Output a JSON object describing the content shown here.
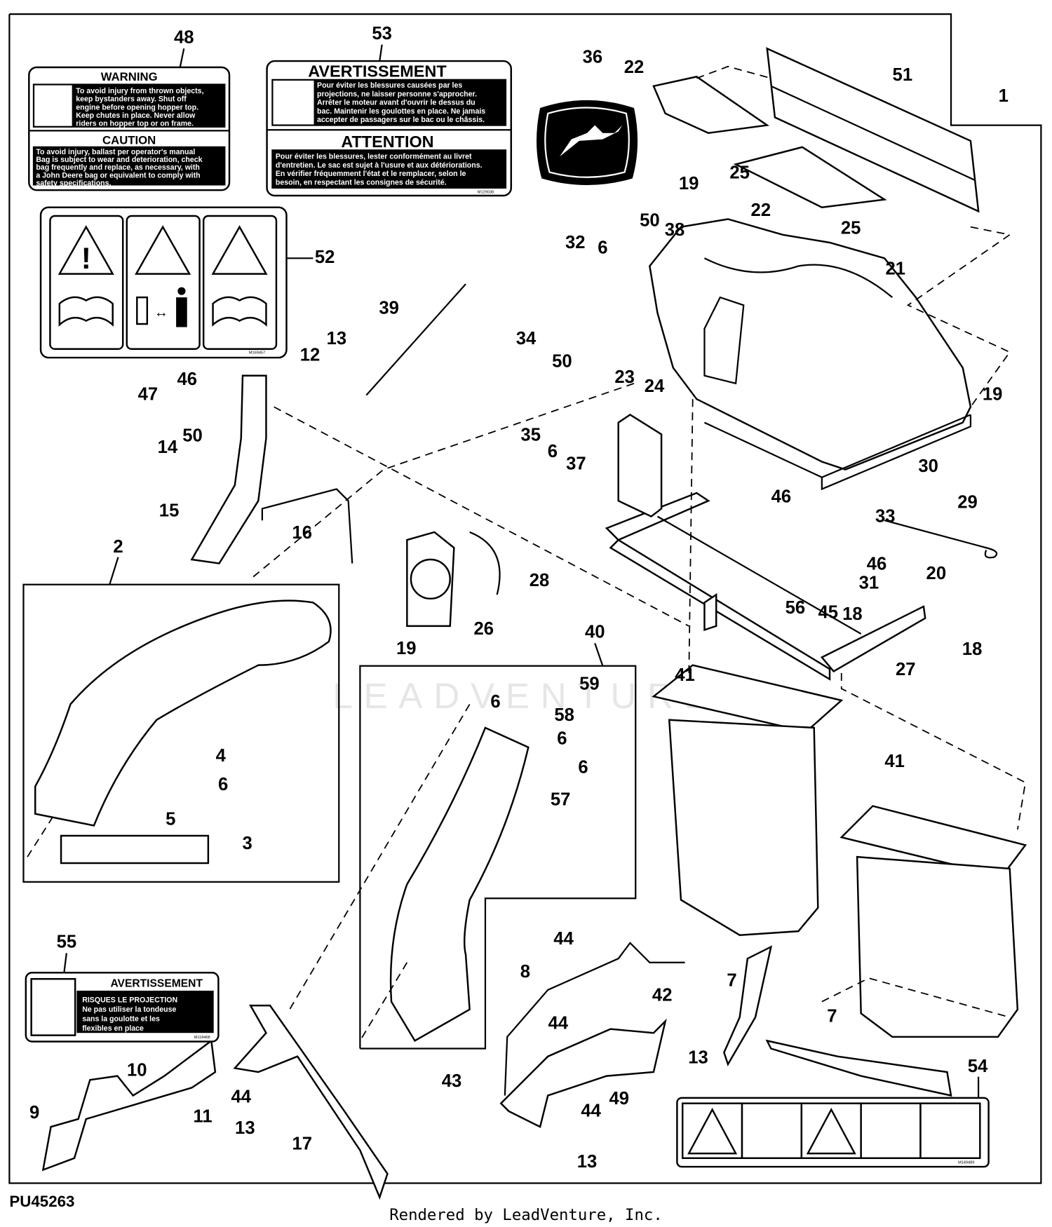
{
  "diagram_id": "PU45263",
  "credit": "Rendered by LeadVenture, Inc.",
  "watermark": "LEADVENTURE",
  "labels": {
    "warning_48": {
      "callout": "48",
      "title1": "WARNING",
      "text1": [
        "To avoid injury from thrown objects,",
        "keep bystanders away. Shut off",
        "engine before opening hopper top.",
        "Keep chutes in place. Never allow",
        "riders on hopper top or on frame."
      ],
      "title2": "CAUTION",
      "text2": [
        "To avoid injury, ballast per operator's manual",
        "Bag is subject to wear and deterioration, check",
        "bag frequently and replace, as necessary, with",
        "a John Deere bag or equivalent to comply with",
        "safety specifications."
      ]
    },
    "avertissement_53": {
      "callout": "53",
      "title1": "AVERTISSEMENT",
      "text1": [
        "Pour éviter les blessures causées par les",
        "projections, ne laisser personne s'approcher.",
        "Arrêter le moteur avant d'ouvrir le dessus du",
        "bac. Maintenir les goulottes en place. Ne jamais",
        "accepter de passagers sur le bac ou le châssis."
      ],
      "title2": "ATTENTION",
      "text2": [
        "Pour éviter les blessures, lester conformément au livret",
        "d'entretien. Le sac est sujet à l'usure et aux détériorations.",
        "En vérifier fréquemment l'état et le remplacer, selon le",
        "besoin, en respectant les consignes de sécurité."
      ],
      "code": "M129038"
    },
    "pictorial_52": {
      "callout": "52",
      "code": "M169457"
    },
    "avertissement_55": {
      "callout": "55",
      "title": "AVERTISSEMENT",
      "text": [
        "RISQUES LE PROJECTION",
        "Ne pas utiliser la tondeuse",
        "sans la goulotte et les",
        "flexibles en place"
      ],
      "code": "M118468"
    },
    "pictorial_54": {
      "callout": "54",
      "code": "M149489"
    }
  },
  "callouts": [
    "36",
    "22",
    "51",
    "1",
    "25",
    "19",
    "22",
    "25",
    "50",
    "38",
    "32",
    "6",
    "21",
    "39",
    "13",
    "12",
    "34",
    "50",
    "46",
    "47",
    "23",
    "24",
    "19",
    "14",
    "50",
    "35",
    "6",
    "37",
    "30",
    "46",
    "33",
    "29",
    "15",
    "16",
    "2",
    "46",
    "20",
    "31",
    "28",
    "56",
    "45",
    "18",
    "26",
    "19",
    "40",
    "41",
    "18",
    "27",
    "59",
    "6",
    "58",
    "6",
    "4",
    "6",
    "6",
    "57",
    "41",
    "5",
    "3",
    "44",
    "8",
    "7",
    "42",
    "44",
    "13",
    "7",
    "10",
    "11",
    "44",
    "9",
    "13",
    "17",
    "43",
    "49",
    "44",
    "13"
  ]
}
